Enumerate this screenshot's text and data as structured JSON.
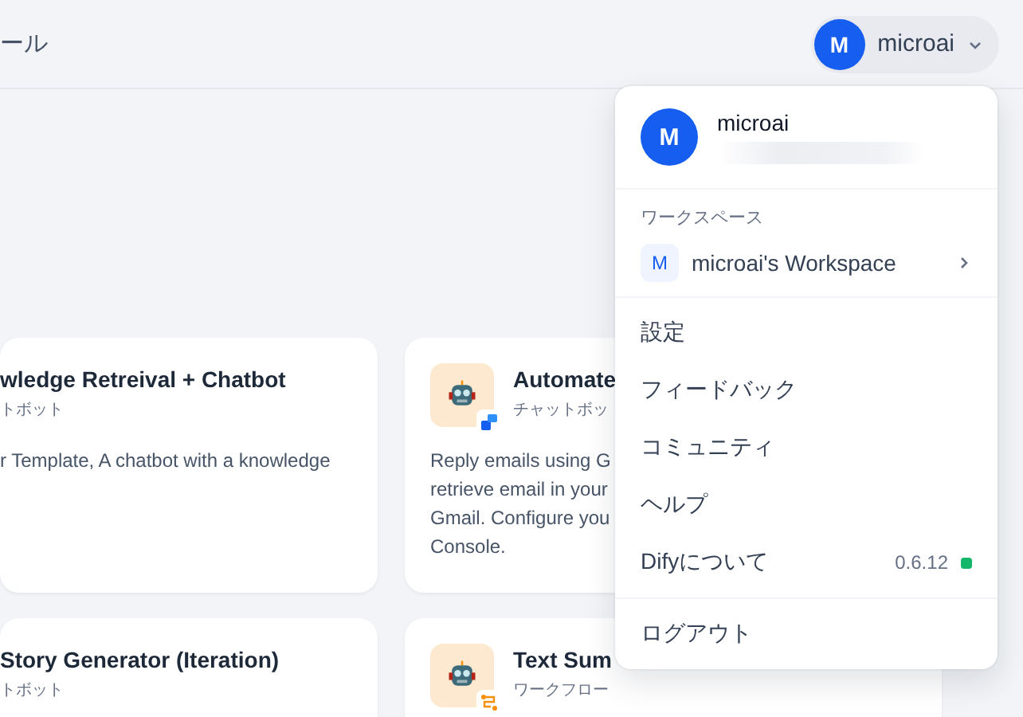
{
  "header": {
    "title": "ール",
    "account": {
      "avatar": "M",
      "name": "microai"
    }
  },
  "cards": [
    {
      "title": "wledge Retreival + Chatbot",
      "type": "トボット",
      "description": [
        "r Template, A chatbot with a knowledge"
      ]
    },
    {
      "title": "Automate",
      "type": "チャットボッ",
      "kind": "chatbot",
      "description": [
        "Reply emails using G",
        "retrieve email in your",
        "Gmail. Configure you",
        "Console."
      ]
    },
    {
      "title": "Story Generator (Iteration)",
      "type": "トボット"
    },
    {
      "title": "Text Sum",
      "type": "ワークフロー",
      "kind": "workflow"
    }
  ],
  "menu": {
    "user": {
      "avatar": "M",
      "name": "microai"
    },
    "workspace_label": "ワークスペース",
    "workspace": {
      "avatar": "M",
      "name": "microai's Workspace"
    },
    "items": [
      {
        "label": "設定"
      },
      {
        "label": "フィードバック"
      },
      {
        "label": "コミュニティ"
      },
      {
        "label": "ヘルプ"
      },
      {
        "label": "Difyについて",
        "version": "0.6.12"
      }
    ],
    "logout": "ログアウト"
  }
}
